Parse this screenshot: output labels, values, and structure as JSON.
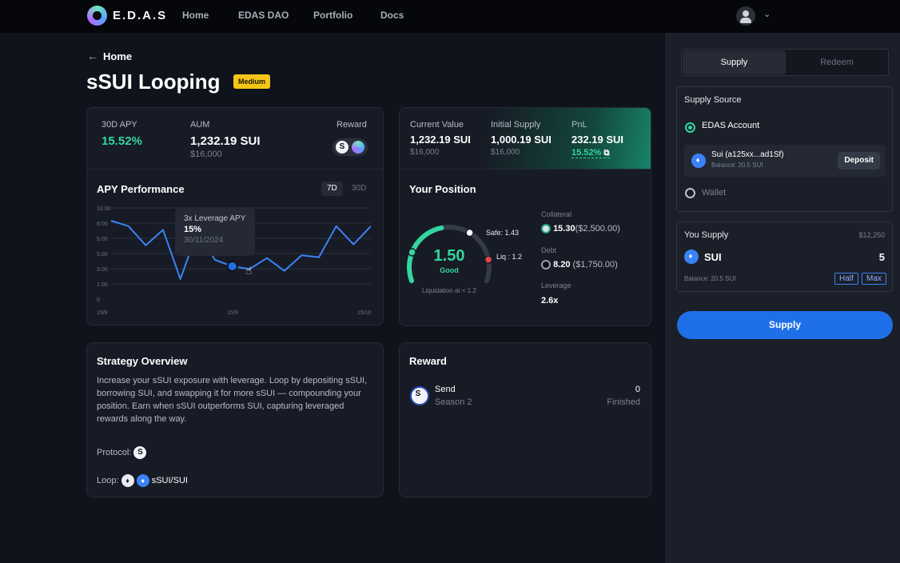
{
  "nav": {
    "brand": "E.D.A.S",
    "links": [
      "Home",
      "EDAS DAO",
      "Portfolio",
      "Docs"
    ]
  },
  "page": {
    "back_label": "Home",
    "title": "sSUI Looping",
    "risk_badge": "Medium"
  },
  "stats": {
    "apy_label": "30D APY",
    "apy_value": "15.52%",
    "aum_label": "AUM",
    "aum_value": "1,232.19 SUI",
    "aum_usd": "$16,000",
    "reward_label": "Reward"
  },
  "position_summary": {
    "current_label": "Current Value",
    "current_value": "1,232.19 SUI",
    "current_usd": "$16,000",
    "initial_label": "Initial Supply",
    "initial_value": "1,000.19 SUI",
    "initial_usd": "$16,000",
    "pnl_label": "PnL",
    "pnl_value": "232.19 SUI",
    "pnl_pct": "15.52%"
  },
  "apy_chart": {
    "title": "APY Performance",
    "range_options": [
      "7D",
      "30D"
    ],
    "selected_range": "7D",
    "tooltip": {
      "label": "3x Leverage APY",
      "value": "15%",
      "date": "30/11/2024"
    }
  },
  "chart_data": {
    "type": "line",
    "title": "APY Performance",
    "ylim": [
      0,
      10
    ],
    "yticks": [
      "10.00",
      "8.00",
      "5.00",
      "5.00",
      "3.00",
      "1.00",
      "0"
    ],
    "xticks": [
      "15/8",
      "15/9",
      "15/10"
    ],
    "x": [
      0,
      1,
      2,
      3,
      4,
      5,
      6,
      7,
      8,
      9,
      10,
      11,
      12,
      13,
      14,
      15
    ],
    "series": [
      {
        "values": [
          8.6,
          8.0,
          5.9,
          7.6,
          2.2,
          7.5,
          4.3,
          3.6,
          3.3,
          4.5,
          3.1,
          4.8,
          4.6,
          8.0,
          6.0,
          8.0
        ]
      }
    ],
    "highlight_index": 7,
    "grid": true
  },
  "your_position": {
    "title": "Your Position",
    "health_value": "1.50",
    "health_status": "Good",
    "health_fraction": 0.55,
    "safe_label": "Safe: 1.43",
    "liq_label": "Liq : 1.2",
    "liq_note": "Liquidation at < 1.2",
    "collateral_label": "Collateral",
    "collateral_amount": "15.30",
    "collateral_usd": "($2,500.00)",
    "debt_label": "Debt",
    "debt_amount": "8.20",
    "debt_usd": "($1,750.00)",
    "leverage_label": "Leverage",
    "leverage_value": "2.6x"
  },
  "strategy": {
    "title": "Strategy Overview",
    "description": "Increase your sSUI exposure with leverage. Loop by depositing sSUI, borrowing SUI, and swapping it for more sSUI — compounding your position. Earn when sSUI outperforms SUI, capturing leveraged rewards along the way.",
    "protocol_label": "Protocol:",
    "loop_label": "Loop:",
    "loop_pair": "sSUI/SUI"
  },
  "reward_card": {
    "title": "Reward",
    "name": "Send",
    "season": "Season 2",
    "count": "0",
    "status": "Finished"
  },
  "panel": {
    "tabs": [
      "Supply",
      "Redeem"
    ],
    "active_tab": "Supply",
    "source_title": "Supply Source",
    "source_edas": "EDAS Account",
    "account_name": "Sui (a125xx...ad1Sf)",
    "account_balance": "Balance: 20.5 SUI",
    "deposit_label": "Deposit",
    "source_wallet": "Wallet",
    "you_supply_label": "You Supply",
    "you_supply_usd": "$12,250",
    "token": "SUI",
    "amount": "5",
    "balance": "Balance: 20.5 SUI",
    "half_label": "Half",
    "max_label": "Max",
    "submit_label": "Supply"
  },
  "colors": {
    "accent": "#1f6fe8",
    "green": "#33d69f",
    "badge": "#f5c518",
    "danger": "#e04848"
  }
}
